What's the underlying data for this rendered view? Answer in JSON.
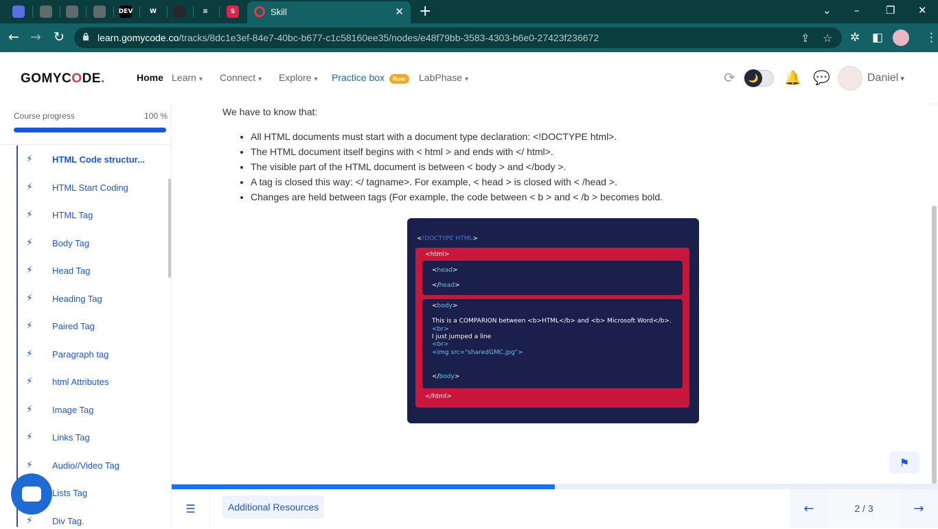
{
  "browser": {
    "tab_title": "Skill",
    "tab_close": "✕",
    "new_tab": "+",
    "favicons": [
      {
        "name": "chrome-app-icon",
        "color": "#5b6ee1",
        "glyph": ""
      },
      {
        "name": "globe-icon",
        "color": "#5f6b6b",
        "glyph": ""
      },
      {
        "name": "globe-icon",
        "color": "#5f6b6b",
        "glyph": ""
      },
      {
        "name": "globe-icon",
        "color": "#5f6b6b",
        "glyph": ""
      },
      {
        "name": "dev-icon",
        "color": "#000000",
        "glyph": "DEV"
      },
      {
        "name": "w-icon",
        "color": "#0b3d3f",
        "glyph": "W"
      },
      {
        "name": "github-icon",
        "color": "#24292e",
        "glyph": ""
      },
      {
        "name": "stackoverflow-icon",
        "color": "#0b3d3f",
        "glyph": "≡"
      },
      {
        "name": "nest-icon",
        "color": "#e0234e",
        "glyph": "S"
      }
    ],
    "url_host": "learn.gomycode.co",
    "url_path": "/tracks/8dc1e3ef-84e7-40bc-b677-c1c58160ee35/nodes/e48f79bb-3583-4303-b6e0-27423f236672",
    "window_minimize": "⌄",
    "window_min": "–",
    "window_restore": "❐",
    "window_close": "✕"
  },
  "header": {
    "logo_prefix": "GOMYC",
    "logo_o": "O",
    "logo_suffix": "DE",
    "logo_dot": ".",
    "nav": {
      "home": "Home",
      "learn": "Learn",
      "connect": "Connect",
      "explore": "Explore",
      "practice": "Practice box",
      "practice_badge": "New",
      "labphase": "LabPhase"
    },
    "user_name": "Daniel",
    "moon": "🌙"
  },
  "sidebar": {
    "progress_label": "Course progress",
    "progress_value": "100 %",
    "progress_fraction": 1.0,
    "lessons": [
      "HTML Code structur...",
      "HTML Start Coding",
      "HTML Tag",
      "Body Tag",
      "Head Tag",
      "Heading Tag",
      "Paired Tag",
      "Paragraph tag",
      "html Attributes",
      "Image Tag",
      "Links Tag",
      "Audio//Video Tag",
      "Lists Tag",
      "Div Tag."
    ]
  },
  "content": {
    "intro": "We have to know that:",
    "bullets": [
      "All HTML documents must start with a document type declaration: <!DOCTYPE html>.",
      "The HTML document itself begins with < html > and ends with </ html>.",
      "The visible part of the HTML document is between < body > and </body >.",
      "A tag is closed this way: </ tagname>. For example, < head > is closed with < /head >.",
      "Changes are held between tags (For example, the code between < b > and < /b > becomes bold."
    ],
    "code": {
      "doctype_lt": "<",
      "doctype": "!DOCTYPE HTML",
      "doctype_gt": ">",
      "html_open": "<html>",
      "head_open_lt": "<",
      "head_open": "head",
      "head_open_gt": ">",
      "head_close_lt": "</",
      "head_close": "head",
      "head_close_gt": ">",
      "body_open_lt": "<",
      "body_open": "body",
      "body_open_gt": ">",
      "line1": "This is a COMPARION between <b>HTML</b> and <b> Microsoft Word</b>.",
      "br1": "<br>",
      "line2": "I just jumped a line",
      "br2": "<br>",
      "img": "<img src=\"sharedGMC.jpg\">",
      "body_close_lt": "</",
      "body_close": "body",
      "body_close_gt": ">",
      "html_close": "</html>"
    }
  },
  "bottom": {
    "lesson_progress_fraction": 0.5,
    "resources": "Additional Resources",
    "pager": "2 / 3",
    "prev": "←",
    "next": "→"
  }
}
